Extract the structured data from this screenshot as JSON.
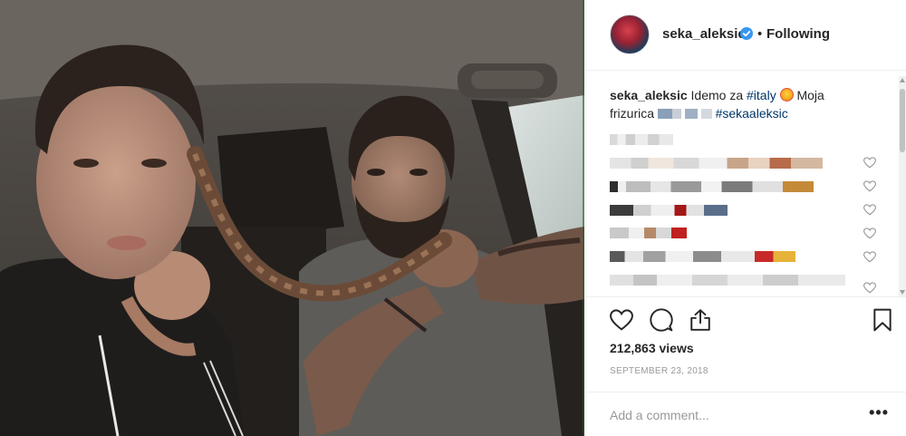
{
  "post": {
    "username": "seka_aleksic",
    "separator": "•",
    "follow_status": "Following",
    "caption_username": "seka_aleksic",
    "caption_text_1": " Idemo za ",
    "caption_hashtag_1": "#italy",
    "caption_text_2": " Moja frizurica",
    "caption_hashtag_2": "#sekaaleksic",
    "views": "212,863 views",
    "date": "SEPTEMBER 23, 2018",
    "add_comment_placeholder": "Add a comment...",
    "more_label": "•••"
  },
  "icons": {
    "verified": "verified-badge-icon",
    "like": "heart-icon",
    "comment": "comment-icon",
    "share": "share-icon",
    "save": "bookmark-icon"
  },
  "colors": {
    "accent": "#3897f0",
    "hashtag": "#003569",
    "text": "#262626",
    "muted": "#999999",
    "border": "#efefef"
  }
}
